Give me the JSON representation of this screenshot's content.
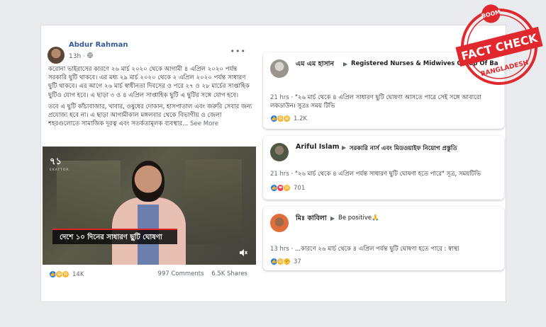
{
  "post": {
    "author": "Abdur Rahman",
    "time": "13h",
    "privacy_icon": "globe-icon",
    "menu": "•••",
    "paragraph1": "করোনা ভাইরাসের কারণে ২৬ মার্চ ২০২০ থেকে আগামী ৪ এপ্রিল ২০২০ পর্যন্ত সরকারি ছুটি থাকবে। এর মধ্য ২৯ মার্চ ২০২০ থেকে ২ এপ্রিল ২০২০ পর্যন্ত সাধারণ ছুটি থাকবে। এর আগে ২৬ মার্চ স্বাধীনতা দিবসের ও পরে ২৭ ও ২৮ মার্চের সাপ্তাহিক ছুটিও যোগ হবে। এ ছাড়া ৩ ও ৪ এপ্রিল সাপ্তাহিক ছুটি এ ছুটির সঙ্গে যোগ হবে।",
    "paragraph2": "তবে এ ছুটি কাঁচাবাজার, খাবার, ওষুধের দোকান, হাসপাতাল এবং জরুরি সেবার জন্য প্রযোজ্য হবে না। এ ছাড়া আগামীকাল মঙ্গলবার থেকে বিভাগীয় ও জেলা শহরগুলোতে সামাজিক দূরত্ব এবং সতর্কতামূলক ব্যবস্থার...",
    "see_more": "See More",
    "video": {
      "channel_logo": "৭১",
      "channel_sub": "EKATTOR",
      "lower_third": "দেশে ১০ দিনের সাধারণ ছুটি ঘোষণা",
      "volume_icon": "speaker-muted-icon"
    },
    "reactions_count": "14K",
    "comments": "997 Comments",
    "shares": "6.5K Shares"
  },
  "comments": [
    {
      "name": "এম এম হাসান",
      "group": "Registered Nurses & Midwives Group Of Ba",
      "time": "21 hrs",
      "text": "\"২৬ মার্চ থেকে ৪ এপ্রিল সাধারণ ছুটি ঘোষণা আসতে পারে সেই সঙ্গে আবারো",
      "text2": "লকডাউন। সুত্রঃ সময় টিভি",
      "reactions_count": "1.2K"
    },
    {
      "name": "Ariful Islam",
      "group": "সরকারি নার্স এবং মিডওয়াইফ নিয়োগ প্রস্তুতি",
      "time": "21 hrs",
      "text": "\"২৬ মার্চ থেকে ৪ এপ্রিল পর্যন্ত সাধারণ ছুটি ঘোষণা হতে পারে\" সূত্র, সময়টিভি",
      "reactions_count": "701"
    },
    {
      "name": "মিঃ কাবিলা",
      "group": "Be positive",
      "group_emoji": "🙏",
      "time": "13 hrs",
      "text": "...কারণে ২৬ মার্চ থেকে ৪ এপ্রিল পর্যন্ত ছুটি ঘোষণা হতে পারে : স্বাস্থ্য",
      "reactions_count": "37"
    }
  ],
  "stamp": {
    "top": "BOOM",
    "main": "FACT CHECK",
    "bottom": "BANGLADESH",
    "color": "#e0282e"
  }
}
